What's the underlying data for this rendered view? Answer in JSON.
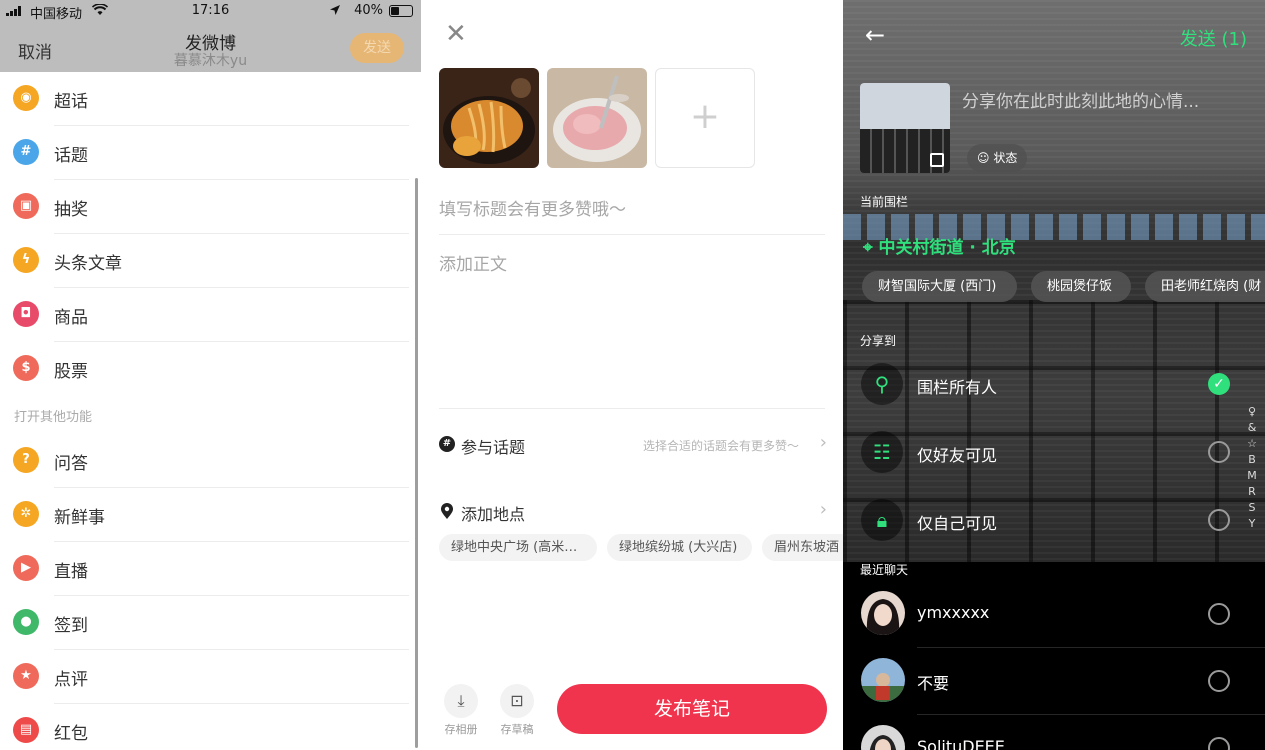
{
  "weibo": {
    "status": {
      "carrier": "中国移动",
      "time": "17:16",
      "battery": "40%"
    },
    "header": {
      "cancel": "取消",
      "title": "发微博",
      "subtitle": "暮慕沐木yu",
      "send": "发送"
    },
    "menu": [
      {
        "label": "超话",
        "icon": "super-topic-icon",
        "color": "#f5a623"
      },
      {
        "label": "话题",
        "icon": "hashtag-icon",
        "color": "#4aa6e8"
      },
      {
        "label": "抽奖",
        "icon": "gift-icon",
        "color": "#ef6a5a"
      },
      {
        "label": "头条文章",
        "icon": "lightning-icon",
        "color": "#f5a623"
      },
      {
        "label": "商品",
        "icon": "shopping-bag-icon",
        "color": "#e84a6a"
      },
      {
        "label": "股票",
        "icon": "dollar-icon",
        "color": "#ef6a5a"
      }
    ],
    "section_label": "打开其他功能",
    "more_menu": [
      {
        "label": "问答",
        "icon": "question-icon",
        "color": "#f5a623"
      },
      {
        "label": "新鲜事",
        "icon": "flower-icon",
        "color": "#f5a623"
      },
      {
        "label": "直播",
        "icon": "live-icon",
        "color": "#ef6a5a"
      },
      {
        "label": "签到",
        "icon": "location-pin-icon",
        "color": "#3fb86a"
      },
      {
        "label": "点评",
        "icon": "review-star-icon",
        "color": "#ef6a5a"
      },
      {
        "label": "红包",
        "icon": "red-packet-icon",
        "color": "#ef4a4a"
      }
    ]
  },
  "note": {
    "title_placeholder": "填写标题会有更多赞哦～",
    "body_placeholder": "添加正文",
    "topic": {
      "label": "参与话题",
      "hint": "选择合适的话题会有更多赞～"
    },
    "location": {
      "label": "添加地点"
    },
    "location_chips": [
      "绿地中央广场 (高米…",
      "绿地缤纷城 (大兴店)",
      "眉州东坡酒"
    ],
    "tools": [
      {
        "label": "存相册",
        "icon": "download-icon"
      },
      {
        "label": "存草稿",
        "icon": "draft-box-icon"
      }
    ],
    "publish": "发布笔记",
    "plus": "+"
  },
  "share": {
    "send": "发送 (1)",
    "placeholder": "分享你在此时此刻此地的心情...",
    "state_btn": "状态",
    "current_fence_label": "当前围栏",
    "fence_name": "中关村街道 · 北京",
    "pois": [
      "财智国际大厦 (西门)",
      "桃园煲仔饭",
      "田老师红烧肉 (财"
    ],
    "share_to_label": "分享到",
    "options": [
      {
        "label": "围栏所有人",
        "icon": "fence-people-icon",
        "selected": true
      },
      {
        "label": "仅好友可见",
        "icon": "friends-icon",
        "selected": false
      },
      {
        "label": "仅自己可见",
        "icon": "lock-icon",
        "selected": false
      }
    ],
    "index_letters": [
      "♀",
      "&",
      "☆",
      "B",
      "M",
      "R",
      "S",
      "Y"
    ],
    "recent_label": "最近聊天",
    "chats": [
      {
        "name": "ymxxxxx"
      },
      {
        "name": "不要"
      },
      {
        "name": "SolituDEEE"
      }
    ],
    "accent": "#2fe07d"
  }
}
